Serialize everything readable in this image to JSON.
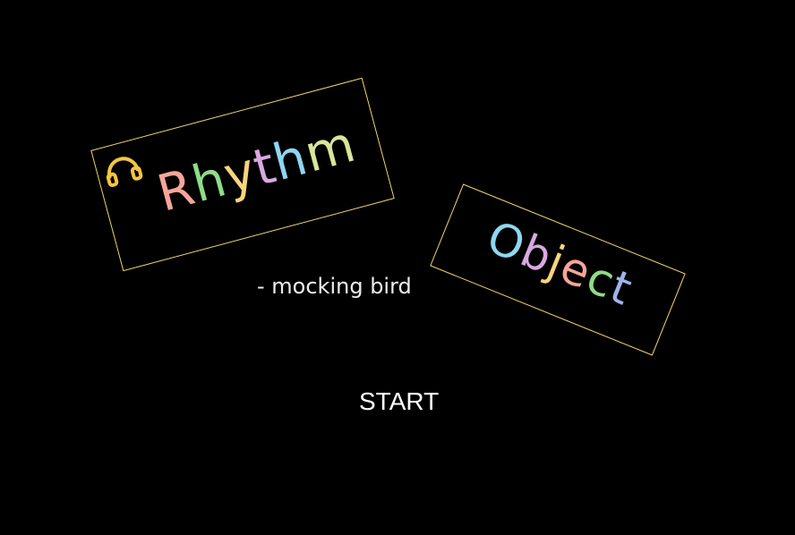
{
  "title": {
    "word1": {
      "letters": [
        {
          "char": "R",
          "color": "#f7a59a"
        },
        {
          "char": "h",
          "color": "#8edc88"
        },
        {
          "char": "y",
          "color": "#f8d47e"
        },
        {
          "char": "t",
          "color": "#d9a8e2"
        },
        {
          "char": "h",
          "color": "#8fd6f1"
        },
        {
          "char": "m",
          "color": "#d8e59b"
        }
      ],
      "icon": "headphones-icon",
      "icon_color": "#f5c542",
      "frame_color": "#f2d36b"
    },
    "word2": {
      "letters": [
        {
          "char": "O",
          "color": "#8fd6f1"
        },
        {
          "char": "b",
          "color": "#d9a8e2"
        },
        {
          "char": "j",
          "color": "#f8d47e"
        },
        {
          "char": "e",
          "color": "#f7a59a"
        },
        {
          "char": "c",
          "color": "#8edc88"
        },
        {
          "char": "t",
          "color": "#9fb4e8"
        }
      ],
      "frame_color": "#f2d36b"
    }
  },
  "subtitle": "- mocking bird",
  "start_label": "START",
  "colors": {
    "background": "#000000",
    "text": "#ffffff"
  }
}
